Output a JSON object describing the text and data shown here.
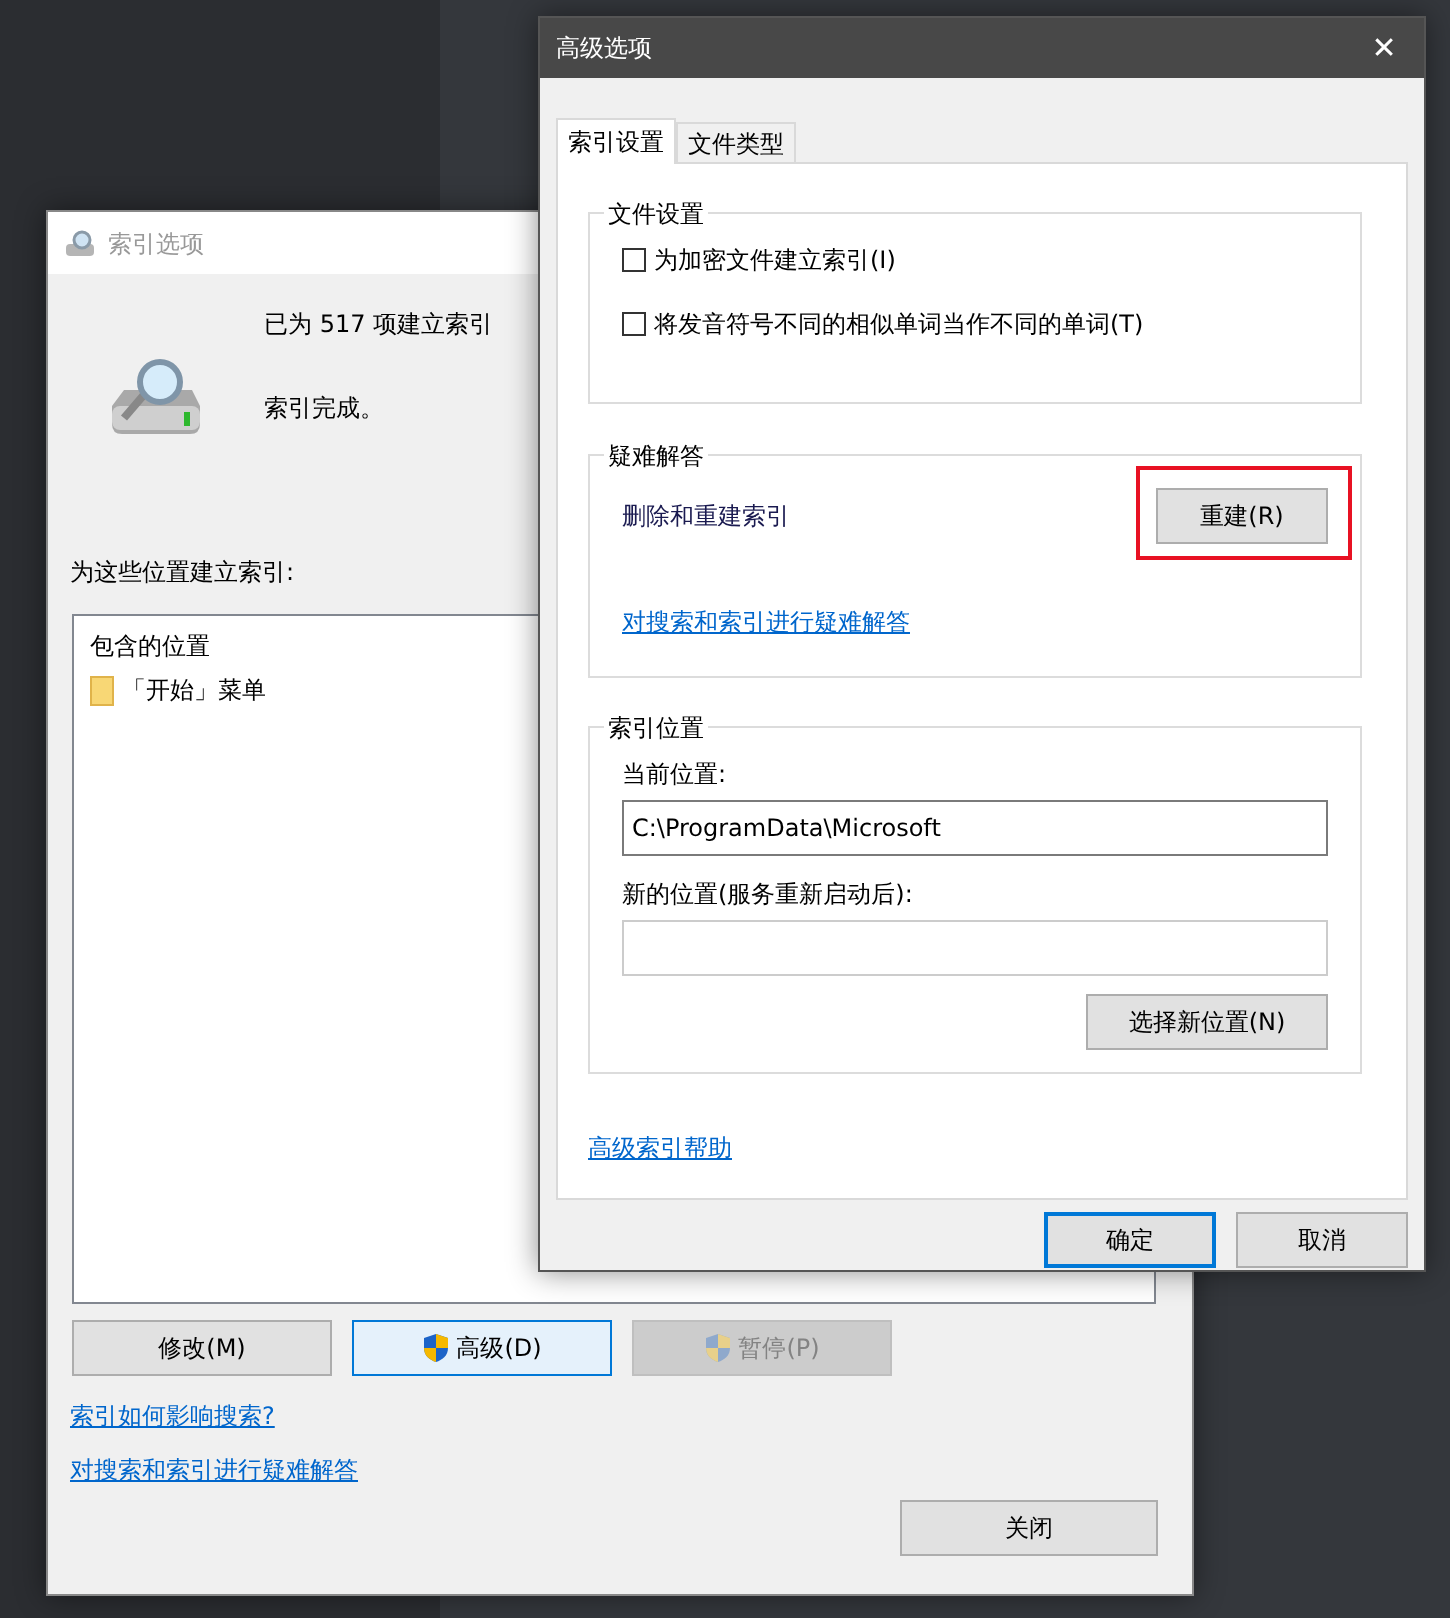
{
  "index_window": {
    "title": "索引选项",
    "status_lines": [
      "已为 517 项建立索引",
      "索引完成。"
    ],
    "locations_label": "为这些位置建立索引:",
    "list": {
      "header": "包含的位置",
      "items": [
        {
          "label": "「开始」菜单"
        }
      ]
    },
    "buttons": [
      {
        "label": "修改(M)",
        "shield": false,
        "focused": false,
        "disabled": false
      },
      {
        "label": "高级(D)",
        "shield": true,
        "focused": true,
        "disabled": false
      },
      {
        "label": "暂停(P)",
        "shield": true,
        "focused": false,
        "disabled": true
      }
    ],
    "links": [
      "索引如何影响搜索?",
      "对搜索和索引进行疑难解答"
    ],
    "close_button": "关闭"
  },
  "advanced_window": {
    "title": "高级选项",
    "close_glyph": "✕",
    "tabs": [
      {
        "label": "索引设置",
        "selected": true
      },
      {
        "label": "文件类型",
        "selected": false
      }
    ],
    "file_settings": {
      "title": "文件设置",
      "checkboxes": [
        {
          "label": "为加密文件建立索引(I)",
          "checked": false
        },
        {
          "label": "将发音符号不同的相似单词当作不同的单词(T)",
          "checked": false
        }
      ]
    },
    "troubleshooting": {
      "title": "疑难解答",
      "text": "删除和重建索引",
      "button": "重建(R)",
      "highlighted": true,
      "link": "对搜索和索引进行疑难解答"
    },
    "index_location": {
      "title": "索引位置",
      "current_label": "当前位置:",
      "current_value": "C:\\ProgramData\\Microsoft",
      "new_label": "新的位置(服务重新启动后):",
      "button": "选择新位置(N)"
    },
    "help_link": "高级索引帮助",
    "buttons": [
      {
        "label": "确定",
        "default": true
      },
      {
        "label": "取消",
        "default": false
      }
    ]
  }
}
